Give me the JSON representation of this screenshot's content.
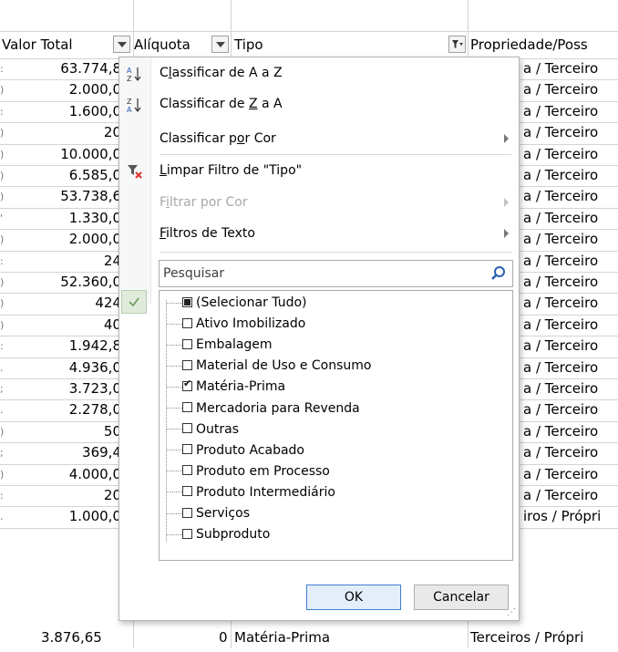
{
  "headers": {
    "valor_total": "Valor Total",
    "aliquota": "Alíquota",
    "tipo": "Tipo",
    "propriedade": "Propriedade/Poss"
  },
  "rows": [
    {
      "lead": ":",
      "valor": "63.774,8",
      "prop": "a / Terceiro"
    },
    {
      "lead": ")",
      "valor": "2.000,0",
      "prop": "a / Terceiro"
    },
    {
      "lead": ":",
      "valor": "1.600,0",
      "prop": "a / Terceiro"
    },
    {
      "lead": ")",
      "valor": "20",
      "prop": "a / Terceiro"
    },
    {
      "lead": ")",
      "valor": "10.000,0",
      "prop": "a / Terceiro"
    },
    {
      "lead": ")",
      "valor": "6.585,0",
      "prop": "a / Terceiro"
    },
    {
      "lead": ")",
      "valor": "53.738,6",
      "prop": "a / Terceiro"
    },
    {
      "lead": "'",
      "valor": "1.330,0",
      "prop": "a / Terceiro"
    },
    {
      "lead": ")",
      "valor": "2.000,0",
      "prop": "a / Terceiro"
    },
    {
      "lead": ":",
      "valor": "24",
      "prop": "a / Terceiro"
    },
    {
      "lead": ")",
      "valor": "52.360,0",
      "prop": "a / Terceiro"
    },
    {
      "lead": ")",
      "valor": "424",
      "prop": "a / Terceiro"
    },
    {
      "lead": ")",
      "valor": "40",
      "prop": "a / Terceiro"
    },
    {
      "lead": ":",
      "valor": "1.942,8",
      "prop": "a / Terceiro"
    },
    {
      "lead": ".",
      "valor": "4.936,0",
      "prop": "a / Terceiro"
    },
    {
      "lead": ";",
      "valor": "3.723,0",
      "prop": "a / Terceiro"
    },
    {
      "lead": ".",
      "valor": "2.278,0",
      "prop": "a / Terceiro"
    },
    {
      "lead": ")",
      "valor": "50",
      "prop": "a / Terceiro"
    },
    {
      "lead": ";",
      "valor": "369,4",
      "prop": "a / Terceiro"
    },
    {
      "lead": ")",
      "valor": "4.000,0",
      "prop": "a / Terceiro"
    },
    {
      "lead": ":",
      "valor": "20",
      "prop": "a / Terceiro"
    },
    {
      "lead": ".",
      "valor": "1.000,0",
      "prop": "iros / Própri"
    }
  ],
  "bottom_row": {
    "valor": "3.876,65",
    "aliquota": "0",
    "tipo": "Matéria-Prima",
    "prop": "Terceiros / Própri"
  },
  "menu": {
    "sort_az_pre": "C",
    "sort_az_u": "l",
    "sort_az_post": "assificar de A a Z",
    "sort_za_pre": "Classificar de ",
    "sort_za_u": "Z",
    "sort_za_post": " a A",
    "sort_color_pre": "Classificar p",
    "sort_color_u": "o",
    "sort_color_post": "r Cor",
    "clear_pre": "",
    "clear_u": "L",
    "clear_post": "impar Filtro de \"Tipo\"",
    "filter_color_pre": "F",
    "filter_color_u": "i",
    "filter_color_post": "ltrar por Cor",
    "text_filters_pre": "",
    "text_filters_u": "F",
    "text_filters_post": "iltros de Texto",
    "search_placeholder": "Pesquisar",
    "items": [
      {
        "label": "(Selecionar Tudo)",
        "state": "partial"
      },
      {
        "label": "Ativo Imobilizado",
        "state": "unchecked"
      },
      {
        "label": "Embalagem",
        "state": "unchecked"
      },
      {
        "label": "Material de Uso e Consumo",
        "state": "unchecked"
      },
      {
        "label": "Matéria-Prima",
        "state": "checked"
      },
      {
        "label": "Mercadoria para Revenda",
        "state": "unchecked"
      },
      {
        "label": "Outras",
        "state": "unchecked"
      },
      {
        "label": "Produto Acabado",
        "state": "unchecked"
      },
      {
        "label": "Produto em Processo",
        "state": "unchecked"
      },
      {
        "label": "Produto Intermediário",
        "state": "unchecked"
      },
      {
        "label": "Serviços",
        "state": "unchecked"
      },
      {
        "label": "Subproduto",
        "state": "unchecked"
      }
    ],
    "ok_label": "OK",
    "cancel_label": "Cancelar"
  },
  "colors": {
    "ok_border": "#3c7fd0",
    "gutter_check": "#e1ebdc",
    "clear_filter_x": "#d9342b"
  }
}
